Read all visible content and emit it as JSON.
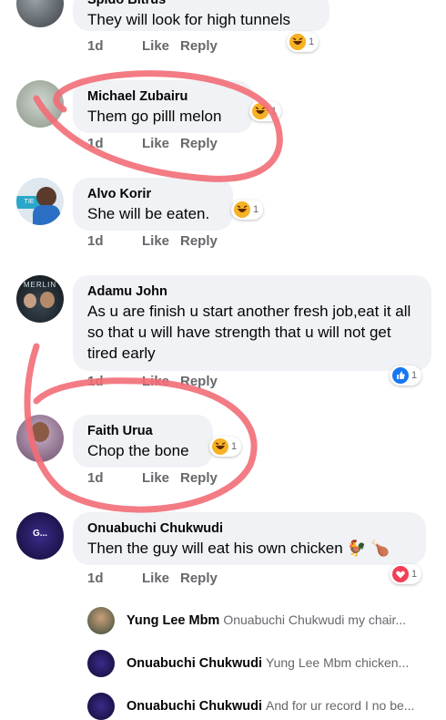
{
  "comments": [
    {
      "author": "Spido Bitrus",
      "text": "They will look for high tunnels",
      "time": "1d",
      "like": "Like",
      "reply": "Reply",
      "reaction_count": "1",
      "reaction": "haha-icon"
    },
    {
      "author": "Michael Zubairu",
      "text": "Them go pilll melon",
      "time": "1d",
      "like": "Like",
      "reply": "Reply",
      "reaction_count": "1",
      "reaction": "haha-icon"
    },
    {
      "author": "Alvo Korir",
      "text": "She will be eaten.",
      "time": "1d",
      "like": "Like",
      "reply": "Reply",
      "reaction_count": "1",
      "reaction": "haha-icon"
    },
    {
      "author": "Adamu John",
      "text": "As u are  finish u start another fresh job,eat it all so that u will have strength that u will not get tired early",
      "time": "1d",
      "like": "Like",
      "reply": "Reply",
      "reaction_count": "1",
      "reaction": "like-icon"
    },
    {
      "author": "Faith Urua",
      "text": "Chop the bone",
      "time": "1d",
      "like": "Like",
      "reply": "Reply",
      "reaction_count": "1",
      "reaction": "haha-icon"
    },
    {
      "author": "Onuabuchi Chukwudi",
      "text": "Then the guy will eat his own chicken 🐓 🍗",
      "time": "1d",
      "like": "Like",
      "reply": "Reply",
      "reaction_count": "1",
      "reaction": "love-icon"
    }
  ],
  "replies": [
    {
      "author": "Yung Lee Mbm",
      "snippet": "Onuabuchi Chukwudi my chair..."
    },
    {
      "author": "Onuabuchi Chukwudi",
      "snippet": "Yung Lee Mbm chicken..."
    },
    {
      "author": "Onuabuchi Chukwudi",
      "snippet": "And for ur record I no be..."
    }
  ],
  "avatar_texts": {
    "alvo": "TIE",
    "adamu": "MERLIN",
    "onuabuchi": "G..."
  },
  "colors": {
    "bubble": "#f0f2f5",
    "meta": "#65676b",
    "like_blue": "#1877f2",
    "love_red": "#f33e58",
    "haha_yellow": "#f7b125",
    "annotation": "#f26d77"
  }
}
